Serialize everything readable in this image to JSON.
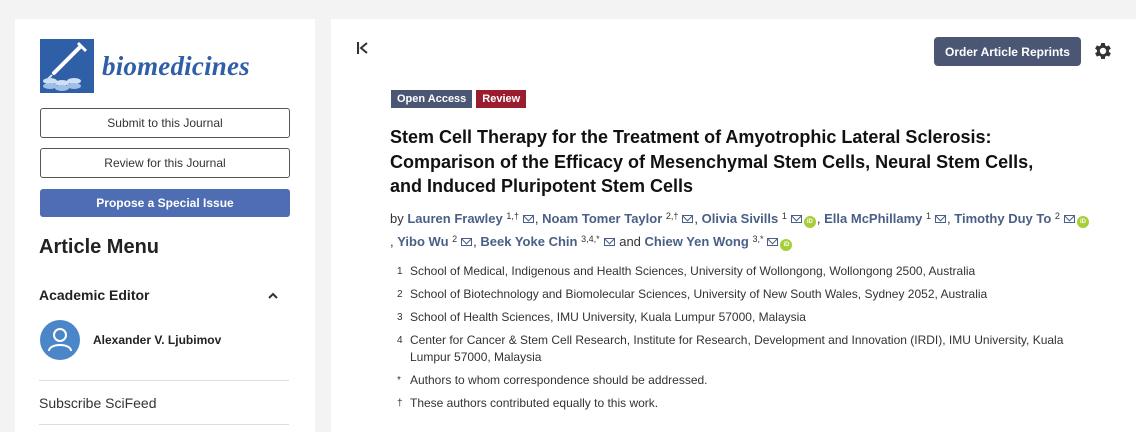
{
  "journal": {
    "name": "biomedicines"
  },
  "sidebar": {
    "submit_label": "Submit to this Journal",
    "review_label": "Review for this Journal",
    "propose_label": "Propose a Special Issue",
    "menu_title": "Article Menu",
    "editor_section_label": "Academic Editor",
    "editor_name": "Alexander V. Ljubimov",
    "subscribe_label": "Subscribe SciFeed"
  },
  "header": {
    "reprints_label": "Order Article Reprints"
  },
  "article": {
    "access_badge": "Open Access",
    "type_badge": "Review",
    "title": "Stem Cell Therapy for the Treatment of Amyotrophic Lateral Sclerosis: Comparison of the Efficacy of Mesenchymal Stem Cells, Neural Stem Cells, and Induced Pluripotent Stem Cells",
    "by_label": "by",
    "and_label": "and",
    "authors": [
      {
        "name": "Lauren Frawley",
        "sup": "1,†",
        "orcid": false
      },
      {
        "name": "Noam Tomer Taylor",
        "sup": "2,†",
        "orcid": false
      },
      {
        "name": "Olivia Sivills",
        "sup": "1",
        "orcid": true
      },
      {
        "name": "Ella McPhillamy",
        "sup": "1",
        "orcid": false
      },
      {
        "name": "Timothy Duy To",
        "sup": "2",
        "orcid": true
      },
      {
        "name": "Yibo Wu",
        "sup": "2",
        "orcid": false
      },
      {
        "name": "Beek Yoke Chin",
        "sup": "3,4,*",
        "orcid": false
      },
      {
        "name": "Chiew Yen Wong",
        "sup": "3,*",
        "orcid": true
      }
    ],
    "affiliations": [
      {
        "mark": "1",
        "text": "School of Medical, Indigenous and Health Sciences, University of Wollongong, Wollongong 2500, Australia"
      },
      {
        "mark": "2",
        "text": "School of Biotechnology and Biomolecular Sciences, University of New South Wales, Sydney 2052, Australia"
      },
      {
        "mark": "3",
        "text": "School of Health Sciences, IMU University, Kuala Lumpur 57000, Malaysia"
      },
      {
        "mark": "4",
        "text": "Center for Cancer & Stem Cell Research, Institute for Research, Development and Innovation (IRDI), IMU University, Kuala Lumpur 57000, Malaysia"
      },
      {
        "mark": "*",
        "text": "Authors to whom correspondence should be addressed."
      },
      {
        "mark": "†",
        "text": "These authors contributed equally to this work."
      }
    ]
  },
  "colors": {
    "brand": "#2f5fa7",
    "primary_button": "#4f6db2",
    "dark_button": "#4b5675",
    "review_badge": "#9b1c2e",
    "author_link": "#4a5f86",
    "orcid": "#a6ce39"
  },
  "icons": {
    "collapse": "collapse-left-icon",
    "settings": "gear-icon",
    "email": "envelope-icon",
    "orcid": "orcid-icon",
    "editor": "user-avatar-icon",
    "section_toggle": "chevron-up-icon"
  }
}
